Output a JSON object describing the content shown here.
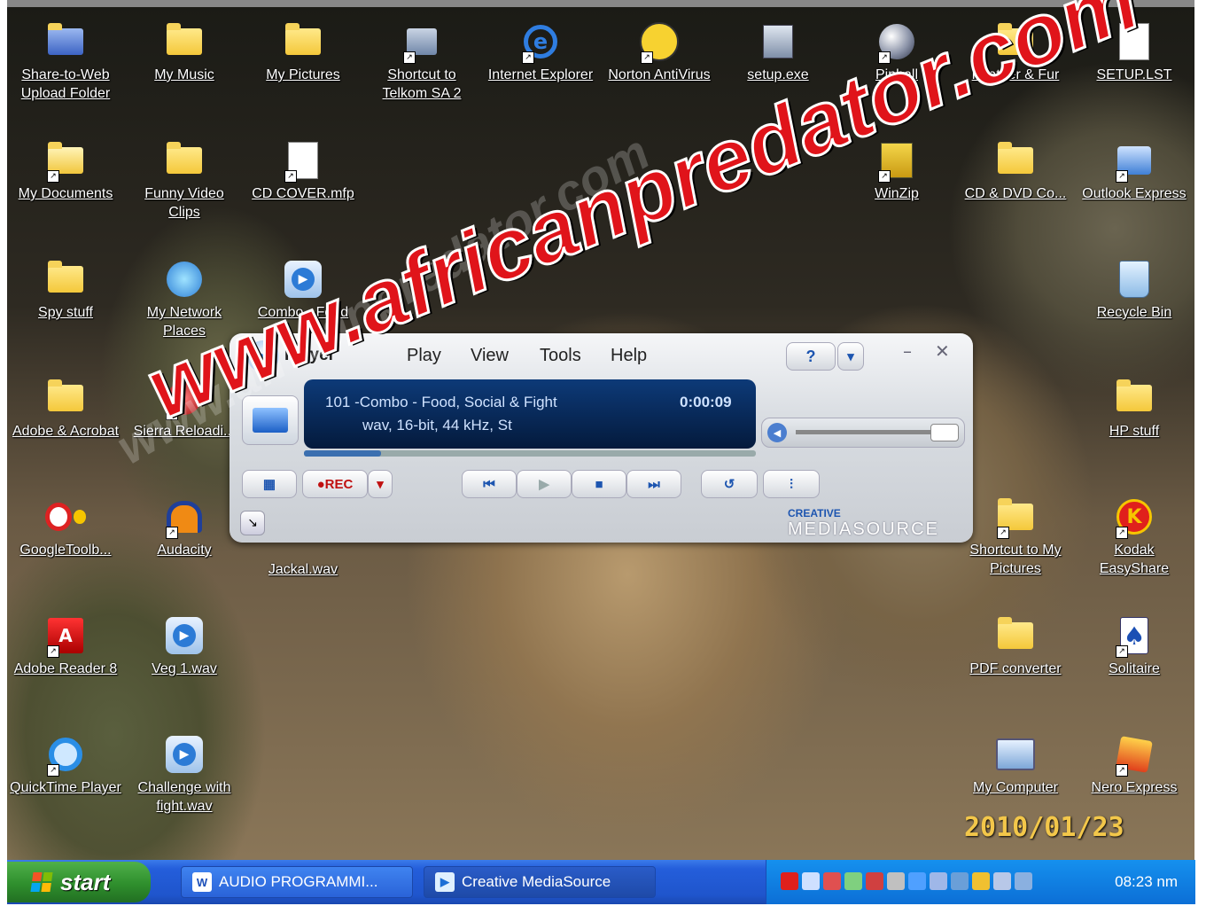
{
  "desktop": {
    "icons": [
      {
        "label": "Share-to-Web Upload Folder",
        "icon": "hp-share-folder-icon"
      },
      {
        "label": "My Music",
        "icon": "music-folder-icon"
      },
      {
        "label": "My Pictures",
        "icon": "pictures-folder-icon"
      },
      {
        "label": "Shortcut to Telkom SA 2",
        "icon": "network-connection-icon"
      },
      {
        "label": "Internet Explorer",
        "icon": "internet-explorer-icon"
      },
      {
        "label": "Norton AntiVirus",
        "icon": "norton-icon"
      },
      {
        "label": "setup.exe",
        "icon": "setup-icon"
      },
      {
        "label": "Pinball",
        "icon": "pinball-icon"
      },
      {
        "label": "Feather & Fur",
        "icon": "folder-icon"
      },
      {
        "label": "SETUP.LST",
        "icon": "text-file-icon"
      },
      {
        "label": "My Documents",
        "icon": "documents-folder-icon"
      },
      {
        "label": "Funny Video Clips",
        "icon": "folder-icon"
      },
      {
        "label": "CD COVER.mfp",
        "icon": "file-icon"
      },
      {
        "label": "WinZip",
        "icon": "winzip-icon"
      },
      {
        "label": "CD & DVD Co...",
        "icon": "folder-icon"
      },
      {
        "label": "Outlook Express",
        "icon": "outlook-express-icon"
      },
      {
        "label": "Spy stuff",
        "icon": "folder-icon"
      },
      {
        "label": "My Network Places",
        "icon": "network-places-icon"
      },
      {
        "label": "Combo - Food",
        "icon": "media-file-icon"
      },
      {
        "label": "Recycle Bin",
        "icon": "recycle-bin-icon"
      },
      {
        "label": "Adobe & Acrobat",
        "icon": "folder-icon"
      },
      {
        "label": "Sierra Reloadi...",
        "icon": "sierra-icon"
      },
      {
        "label": "HP stuff",
        "icon": "folder-icon"
      },
      {
        "label": "GoogleToolb...",
        "icon": "google-toolbar-icon"
      },
      {
        "label": "Audacity",
        "icon": "audacity-icon"
      },
      {
        "label": "Jackal.wav",
        "icon": "media-file-icon"
      },
      {
        "label": "Shortcut to My Pictures",
        "icon": "pictures-folder-icon"
      },
      {
        "label": "Kodak EasyShare",
        "icon": "kodak-icon"
      },
      {
        "label": "Adobe Reader 8",
        "icon": "adobe-reader-icon"
      },
      {
        "label": "Veg 1.wav",
        "icon": "media-file-icon"
      },
      {
        "label": "PDF converter",
        "icon": "folder-icon"
      },
      {
        "label": "Solitaire",
        "icon": "solitaire-icon"
      },
      {
        "label": "QuickTime Player",
        "icon": "quicktime-icon"
      },
      {
        "label": "Challenge with fight.wav",
        "icon": "media-file-icon"
      },
      {
        "label": "My Computer",
        "icon": "my-computer-icon"
      },
      {
        "label": "Nero Express",
        "icon": "nero-icon"
      }
    ],
    "watermark": "www.africanpredator.com",
    "watermark_faint": "www.africanpredator.com",
    "date_stamp": "2010/01/23"
  },
  "player": {
    "title": "Player",
    "menu": [
      "Play",
      "View",
      "Tools",
      "Help"
    ],
    "track_line": "101 -Combo - Food, Social & Fight",
    "format_line": "wav, 16-bit, 44 kHz, St",
    "time": "0:00:09",
    "rec_label": "●REC",
    "help_label": "?",
    "brand_top": "CREATIVE",
    "brand_bottom": "MEDIASOURCE",
    "volume_level": 0.93,
    "seek_progress": 0.17
  },
  "taskbar": {
    "start_label": "start",
    "tasks": [
      {
        "label": "AUDIO PROGRAMMI...",
        "icon": "word-icon"
      },
      {
        "label": "Creative MediaSource",
        "icon": "mediasource-icon"
      }
    ],
    "clock": "08:23 nm"
  },
  "colors": {
    "watermark_red": "#e0141a",
    "taskbar_blue": "#245edb",
    "start_green": "#2f8f2d",
    "tray_blue": "#0c6fd6",
    "date_yellow": "#f3c74a"
  }
}
